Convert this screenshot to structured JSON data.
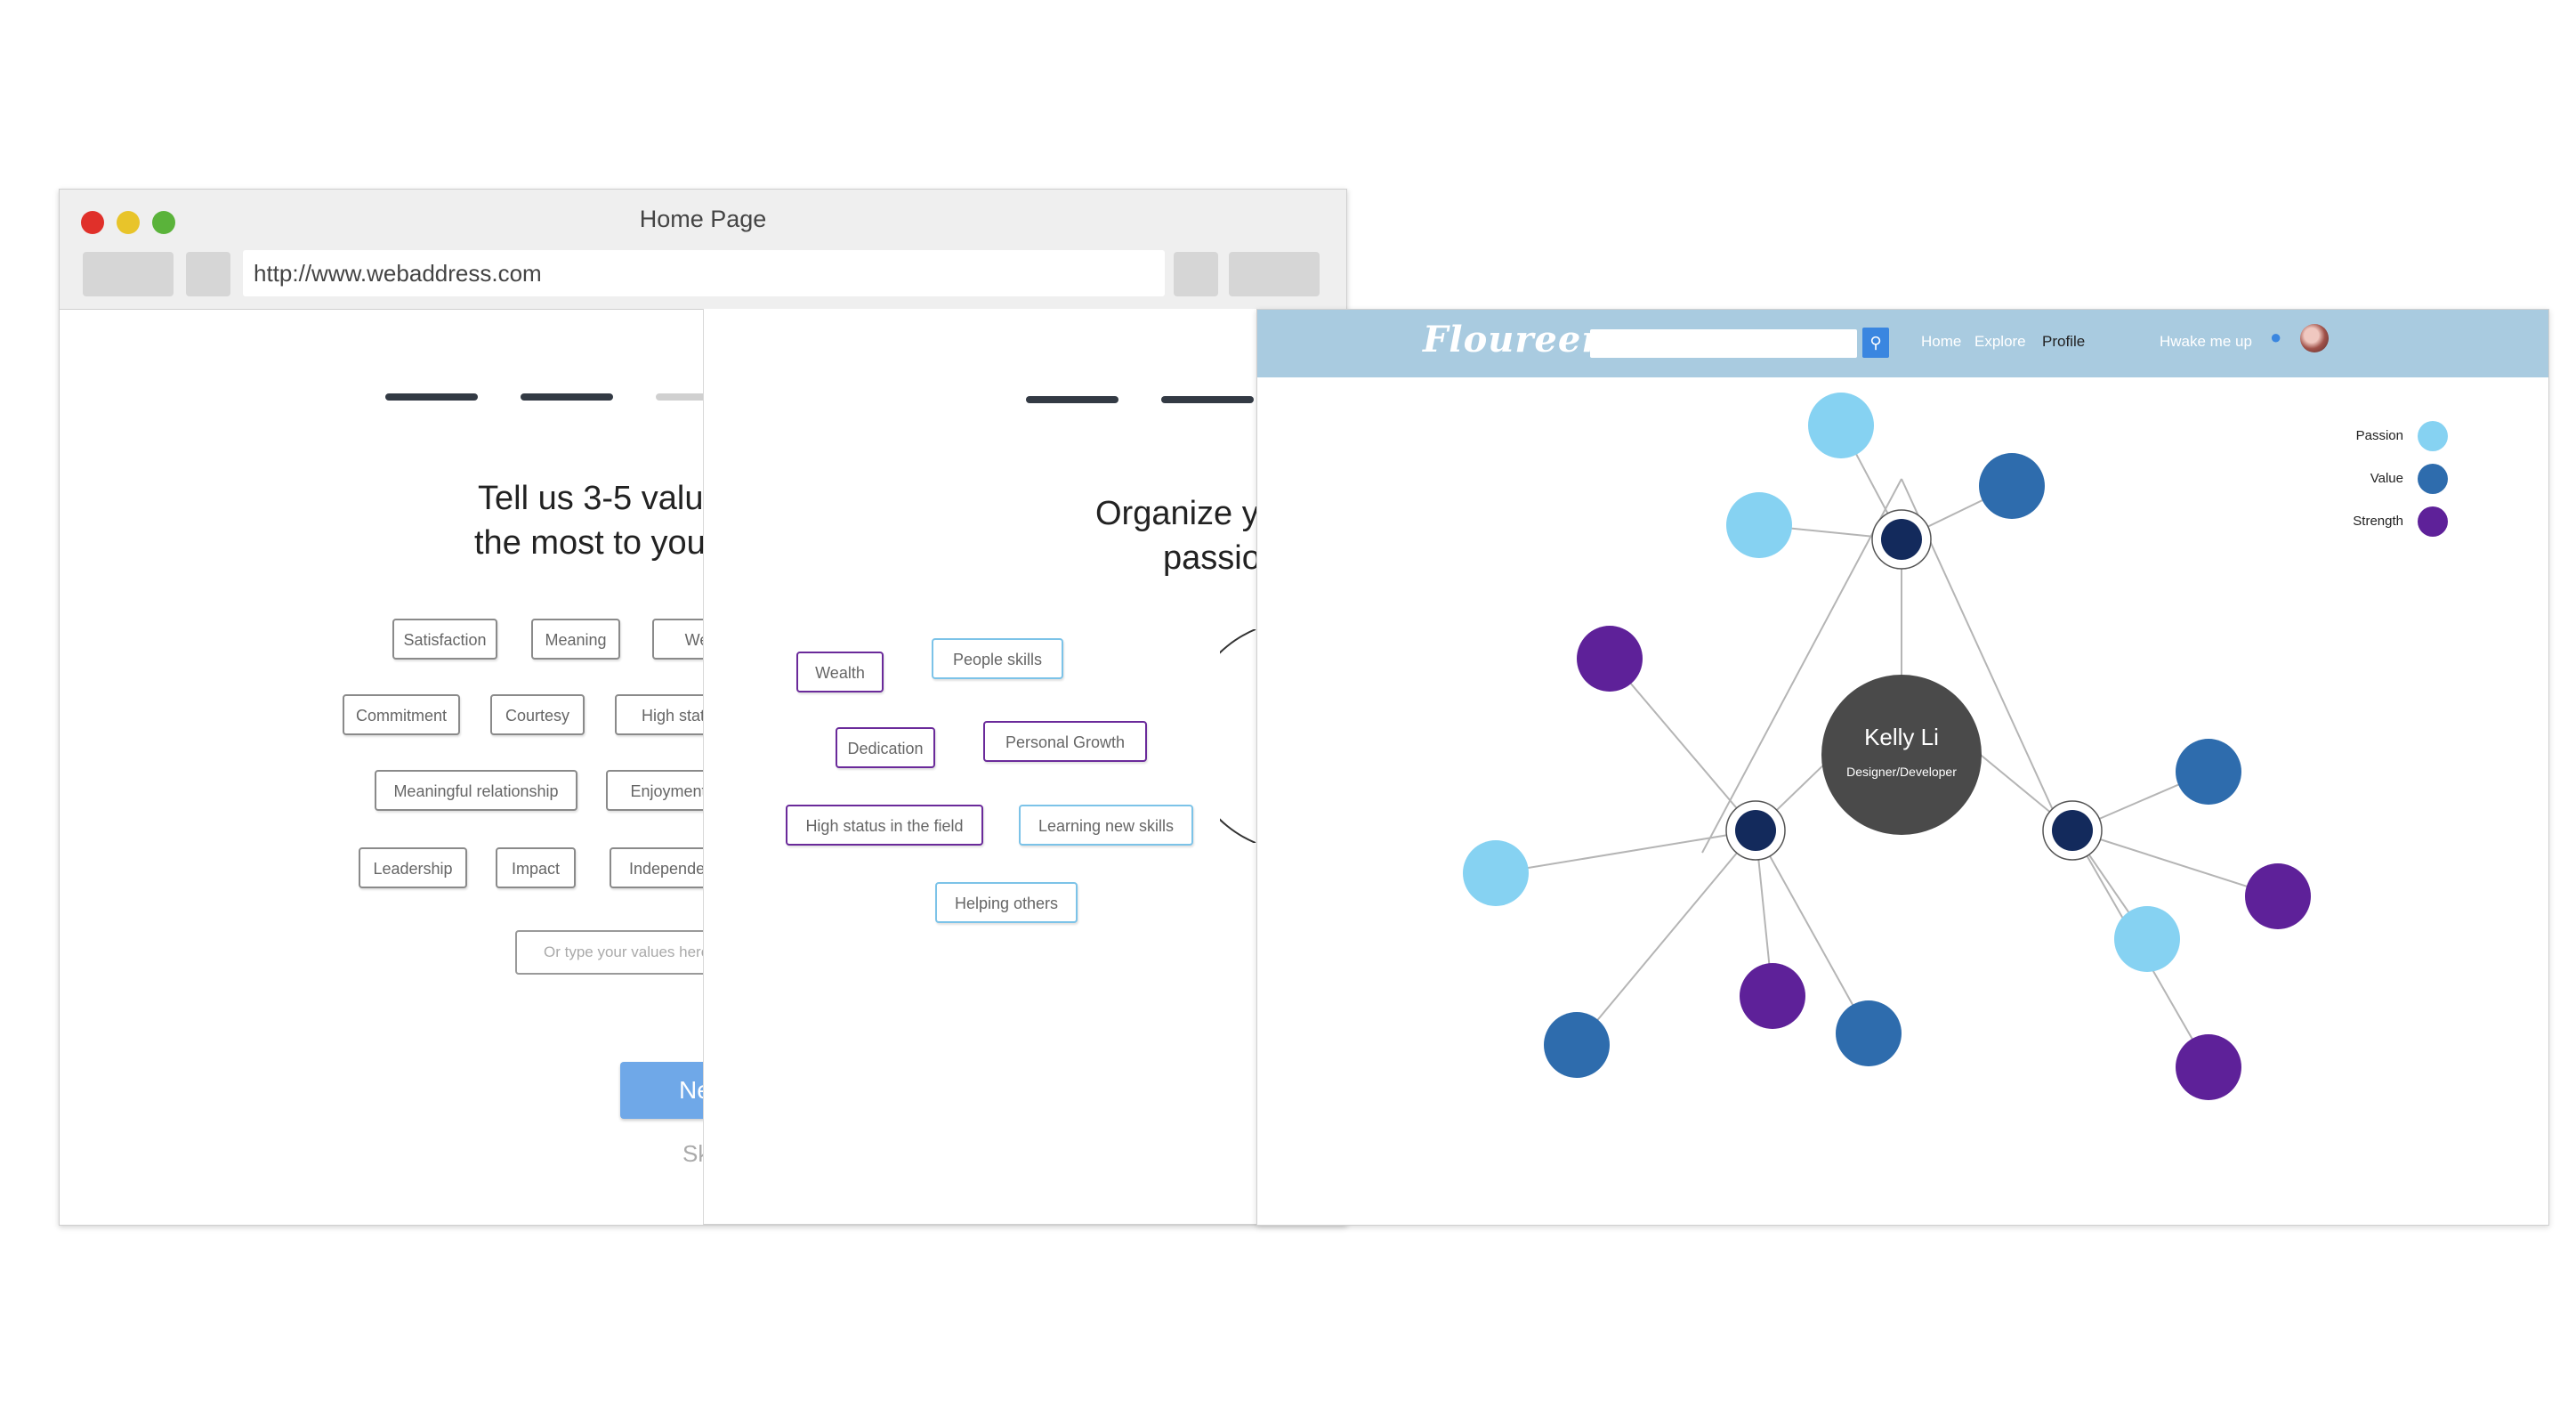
{
  "window": {
    "title": "Home Page",
    "url": "http://www.webaddress.com",
    "dot_colors": [
      "#e0302a",
      "#e8c42a",
      "#5ab33a"
    ]
  },
  "step1": {
    "heading_line1": "Tell us 3-5 valu",
    "heading_line2": "the most to you",
    "values": [
      "Satisfaction",
      "Meaning",
      "Wea",
      "Commitment",
      "Courtesy",
      "High statu",
      "Meaningful relationship",
      "Enjoyment",
      "Leadership",
      "Impact",
      "Independen"
    ],
    "input_placeholder": "Or type your values here",
    "next_label": "Ne",
    "skip_label": "Sk"
  },
  "step2": {
    "heading_line1": "Organize y",
    "heading_line2": "passio",
    "items": [
      "Wealth",
      "People skills",
      "Dedication",
      "Personal Growth",
      "High status in the field",
      "Learning new skills",
      "Helping others"
    ]
  },
  "profile": {
    "brand": "Floureer",
    "nav": [
      "Home",
      "Explore",
      "Profile"
    ],
    "wake_label": "Hwake me up",
    "user_name": "Kelly Li",
    "user_role": "Designer/Developer",
    "legend": [
      {
        "label": "Passion",
        "color": "#86d2f2"
      },
      {
        "label": "Value",
        "color": "#2e6cad"
      },
      {
        "label": "Strength",
        "color": "#5e2199"
      }
    ],
    "hub_color": "#132a5c",
    "center_color": "#4a4a4a",
    "icons": [
      "search-icon",
      "bell-icon",
      "avatar"
    ]
  }
}
